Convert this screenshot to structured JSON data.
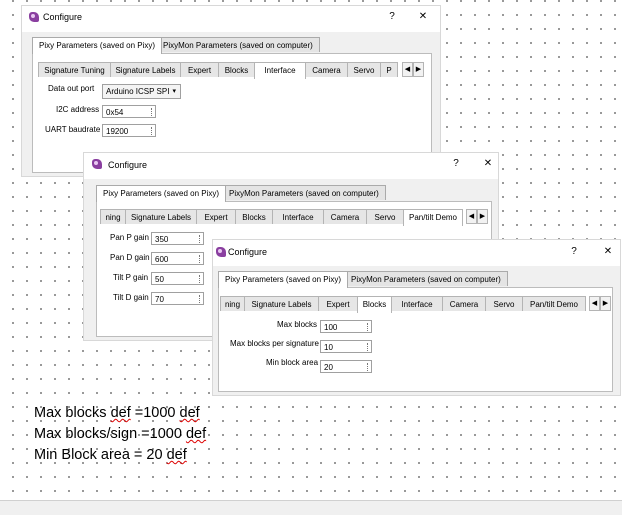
{
  "window1": {
    "title": "Configure",
    "help": "?",
    "close": "✕",
    "outer_tabs": [
      "Pixy Parameters (saved on Pixy)",
      "PixyMon Parameters (saved on computer)"
    ],
    "inner_tabs": [
      "Signature Tuning",
      "Signature Labels",
      "Expert",
      "Blocks",
      "Interface",
      "Camera",
      "Servo",
      "P"
    ],
    "active_inner": "Interface",
    "fields": {
      "data_out_port_label": "Data out port",
      "data_out_port_value": "Arduino ICSP SPI",
      "i2c_label": "I2C address",
      "i2c_value": "0x54",
      "uart_label": "UART baudrate",
      "uart_value": "19200"
    }
  },
  "window2": {
    "title": "Configure",
    "help": "?",
    "close": "✕",
    "outer_tabs": [
      "Pixy Parameters (saved on Pixy)",
      "PixyMon Parameters (saved on computer)"
    ],
    "inner_tabs": [
      "ning",
      "Signature Labels",
      "Expert",
      "Blocks",
      "Interface",
      "Camera",
      "Servo",
      "Pan/tilt Demo"
    ],
    "active_inner": "Pan/tilt Demo",
    "fields": {
      "pan_p_label": "Pan P gain",
      "pan_p_value": "350",
      "pan_d_label": "Pan D gain",
      "pan_d_value": "600",
      "tilt_p_label": "Tilt P gain",
      "tilt_p_value": "50",
      "tilt_d_label": "Tilt D gain",
      "tilt_d_value": "70"
    }
  },
  "window3": {
    "title": "Configure",
    "help": "?",
    "close": "✕",
    "outer_tabs": [
      "Pixy Parameters (saved on Pixy)",
      "PixyMon Parameters (saved on computer)"
    ],
    "inner_tabs": [
      "ning",
      "Signature Labels",
      "Expert",
      "Blocks",
      "Interface",
      "Camera",
      "Servo",
      "Pan/tilt Demo"
    ],
    "active_inner": "Blocks",
    "fields": {
      "max_blocks_label": "Max blocks",
      "max_blocks_value": "100",
      "max_per_sig_label": "Max blocks per signature",
      "max_per_sig_value": "10",
      "min_area_label": "Min block area",
      "min_area_value": "20"
    }
  },
  "notes": {
    "line1_a": "Max blocks ",
    "line1_b": "def",
    "line1_c": " =1000 ",
    "line1_d": "def",
    "line2_a": "Max blocks/sign =1000 ",
    "line2_b": "def",
    "line3_a": "Min Block area = 20 ",
    "line3_b": "def"
  },
  "arrows": {
    "left": "◀",
    "right": "▶"
  },
  "select_caret": "▾",
  "icons": {
    "app": "pixymon-icon"
  }
}
